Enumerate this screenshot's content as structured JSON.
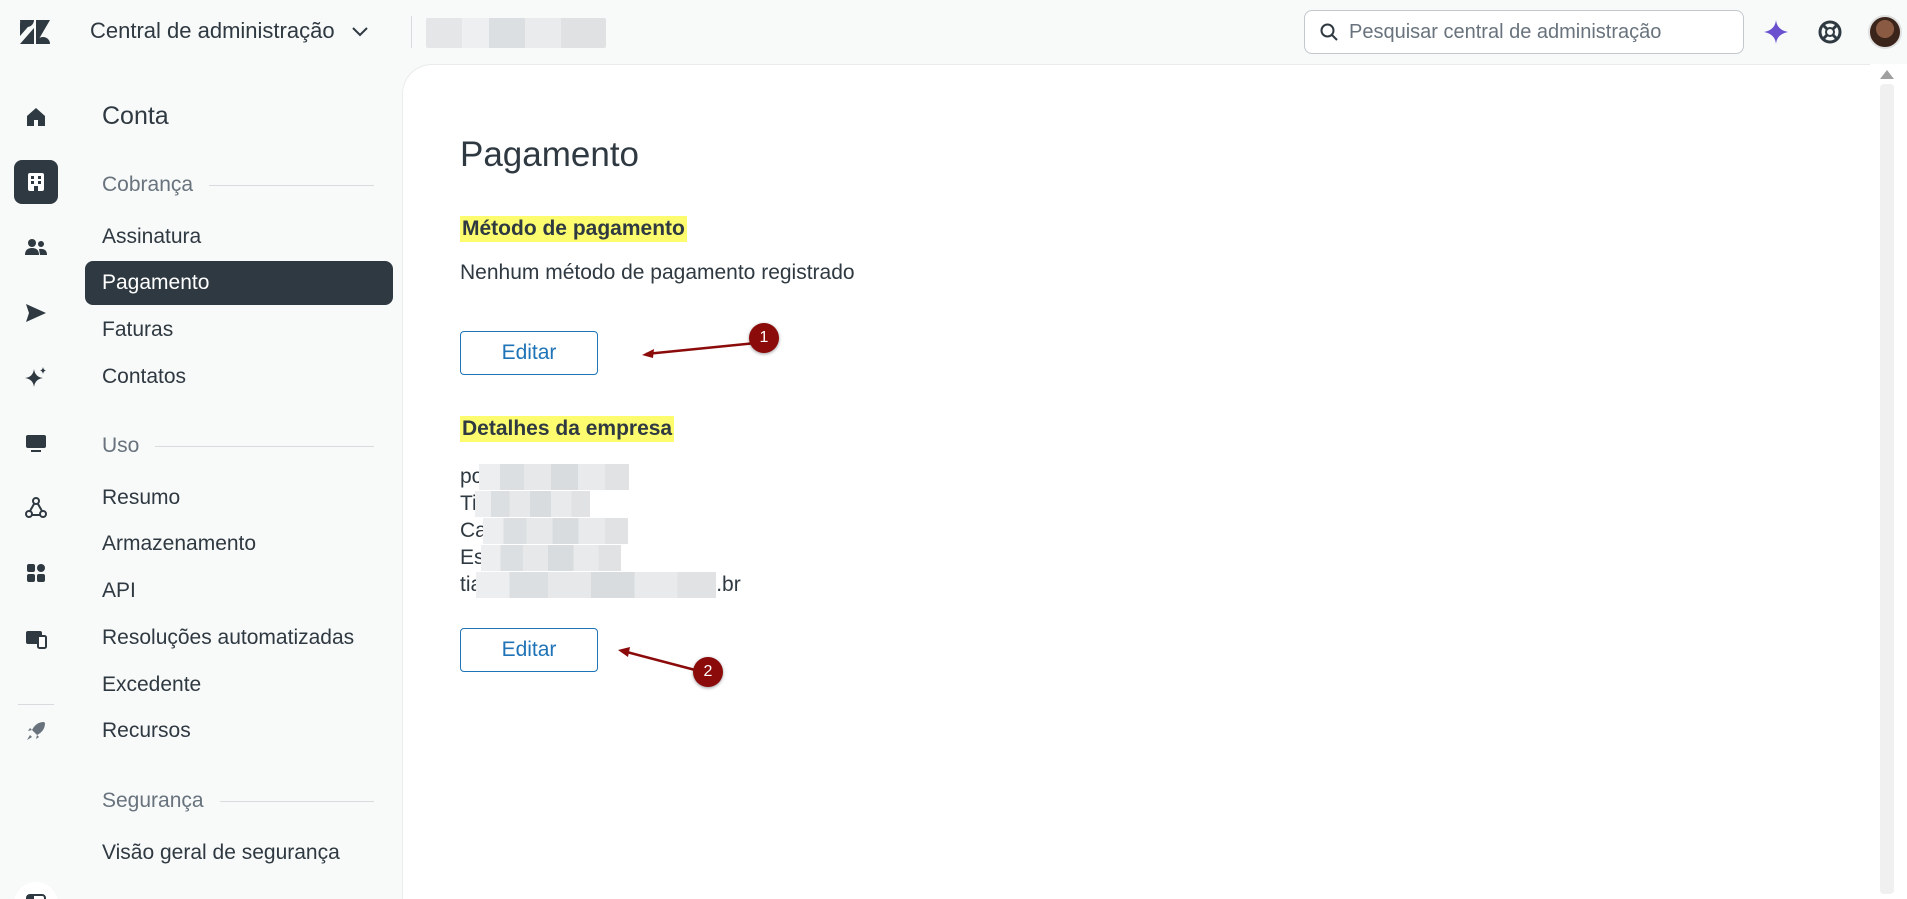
{
  "topbar": {
    "product_title": "Central de administração",
    "search_placeholder": "Pesquisar central de administração"
  },
  "subnav": {
    "title": "Conta",
    "groups": [
      {
        "label": "Cobrança",
        "items": [
          "Assinatura",
          "Pagamento",
          "Faturas",
          "Contatos"
        ]
      },
      {
        "label": "Uso",
        "items": [
          "Resumo",
          "Armazenamento",
          "API",
          "Resoluções automatizadas",
          "Excedente",
          "Recursos"
        ]
      },
      {
        "label": "Segurança",
        "items": [
          "Visão geral de segurança"
        ]
      }
    ],
    "active_item": "Pagamento"
  },
  "main": {
    "page_title": "Pagamento",
    "payment_method": {
      "heading": "Método de pagamento",
      "text": "Nenhum método de pagamento registrado",
      "edit_label": "Editar"
    },
    "company": {
      "heading": "Detalhes da empresa",
      "lines": [
        "po",
        "Ti",
        "Ca",
        "Es",
        "tia"
      ],
      "email_suffix": ".br",
      "edit_label": "Editar"
    }
  },
  "annotations": {
    "badge_1": "1",
    "badge_2": "2"
  },
  "colors": {
    "highlight": "#fcfc6e",
    "accent": "#1f73b7",
    "nav_active": "#2f3941",
    "annotation": "#8b0a0a",
    "ai_spark": "#6a4fcf"
  }
}
